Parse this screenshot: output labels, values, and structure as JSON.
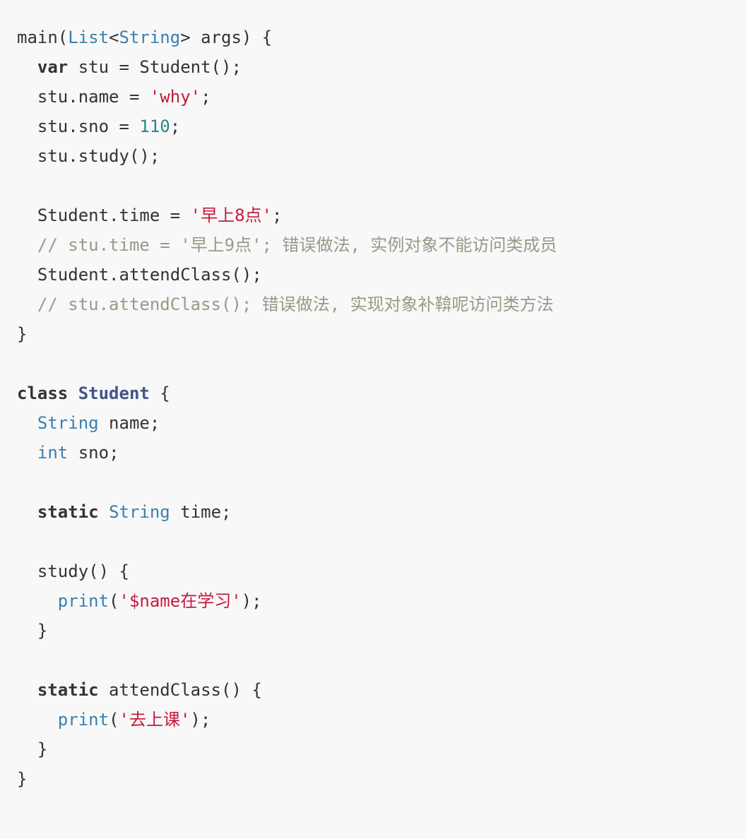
{
  "code": {
    "lines": [
      [
        {
          "t": "main(",
          "c": "plain"
        },
        {
          "t": "List",
          "c": "type"
        },
        {
          "t": "<",
          "c": "plain"
        },
        {
          "t": "String",
          "c": "type"
        },
        {
          "t": "> args) {",
          "c": "plain"
        }
      ],
      [
        {
          "t": "  ",
          "c": "plain"
        },
        {
          "t": "var",
          "c": "kw"
        },
        {
          "t": " stu = Student();",
          "c": "plain"
        }
      ],
      [
        {
          "t": "  stu.name = ",
          "c": "plain"
        },
        {
          "t": "'why'",
          "c": "str"
        },
        {
          "t": ";",
          "c": "plain"
        }
      ],
      [
        {
          "t": "  stu.sno = ",
          "c": "plain"
        },
        {
          "t": "110",
          "c": "num"
        },
        {
          "t": ";",
          "c": "plain"
        }
      ],
      [
        {
          "t": "  stu.study();",
          "c": "plain"
        }
      ],
      [],
      [
        {
          "t": "  Student.time = ",
          "c": "plain"
        },
        {
          "t": "'早上8点'",
          "c": "str"
        },
        {
          "t": ";",
          "c": "plain"
        }
      ],
      [
        {
          "t": "  ",
          "c": "plain"
        },
        {
          "t": "// stu.time = '早上9点'; 错误做法, 实例对象不能访问类成员",
          "c": "cmt"
        }
      ],
      [
        {
          "t": "  Student.attendClass();",
          "c": "plain"
        }
      ],
      [
        {
          "t": "  ",
          "c": "plain"
        },
        {
          "t": "// stu.attendClass(); 错误做法, 实现对象补鞥呢访问类方法",
          "c": "cmt"
        }
      ],
      [
        {
          "t": "}",
          "c": "plain"
        }
      ],
      [],
      [
        {
          "t": "class",
          "c": "kw"
        },
        {
          "t": " ",
          "c": "plain"
        },
        {
          "t": "Student",
          "c": "cls"
        },
        {
          "t": " {",
          "c": "plain"
        }
      ],
      [
        {
          "t": "  ",
          "c": "plain"
        },
        {
          "t": "String",
          "c": "type"
        },
        {
          "t": " name;",
          "c": "plain"
        }
      ],
      [
        {
          "t": "  ",
          "c": "plain"
        },
        {
          "t": "int",
          "c": "type"
        },
        {
          "t": " sno;",
          "c": "plain"
        }
      ],
      [],
      [
        {
          "t": "  ",
          "c": "plain"
        },
        {
          "t": "static",
          "c": "kw"
        },
        {
          "t": " ",
          "c": "plain"
        },
        {
          "t": "String",
          "c": "type"
        },
        {
          "t": " time;",
          "c": "plain"
        }
      ],
      [],
      [
        {
          "t": "  study() {",
          "c": "plain"
        }
      ],
      [
        {
          "t": "    ",
          "c": "plain"
        },
        {
          "t": "print",
          "c": "type"
        },
        {
          "t": "(",
          "c": "plain"
        },
        {
          "t": "'$name在学习'",
          "c": "str"
        },
        {
          "t": ");",
          "c": "plain"
        }
      ],
      [
        {
          "t": "  }",
          "c": "plain"
        }
      ],
      [],
      [
        {
          "t": "  ",
          "c": "plain"
        },
        {
          "t": "static",
          "c": "kw"
        },
        {
          "t": " attendClass() {",
          "c": "plain"
        }
      ],
      [
        {
          "t": "    ",
          "c": "plain"
        },
        {
          "t": "print",
          "c": "type"
        },
        {
          "t": "(",
          "c": "plain"
        },
        {
          "t": "'去上课'",
          "c": "str"
        },
        {
          "t": ");",
          "c": "plain"
        }
      ],
      [
        {
          "t": "  }",
          "c": "plain"
        }
      ],
      [
        {
          "t": "}",
          "c": "plain"
        }
      ]
    ]
  },
  "colors": {
    "background": "#f8f8f8",
    "text": "#333333",
    "keyword": "#333333",
    "type": "#3b7fae",
    "class_name": "#445588",
    "string": "#c41a3a",
    "number": "#2c8787",
    "comment": "#999988"
  }
}
